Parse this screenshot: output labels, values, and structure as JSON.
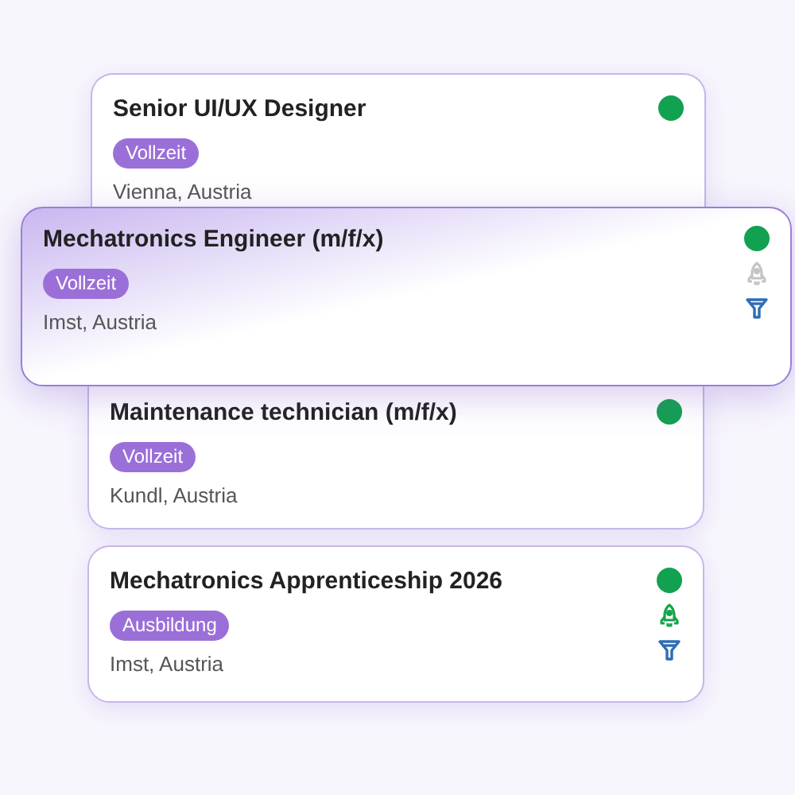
{
  "jobs": [
    {
      "title": "Senior UI/UX Designer",
      "type": "Vollzeit",
      "location": "Vienna, Austria",
      "online": true,
      "selected": false
    },
    {
      "title": "Mechatronics Engineer (m/f/x)",
      "type": "Vollzeit",
      "location": "Imst, Austria",
      "online": true,
      "selected": true,
      "boosted": false,
      "filter": true
    },
    {
      "title": "Maintenance technician (m/f/x)",
      "type": "Vollzeit",
      "location": "Kundl, Austria",
      "online": true,
      "selected": false
    },
    {
      "title": "Mechatronics Apprenticeship 2026",
      "type": "Ausbildung",
      "location": "Imst, Austria",
      "online": true,
      "selected": false,
      "boosted": true,
      "filter": true
    }
  ]
}
